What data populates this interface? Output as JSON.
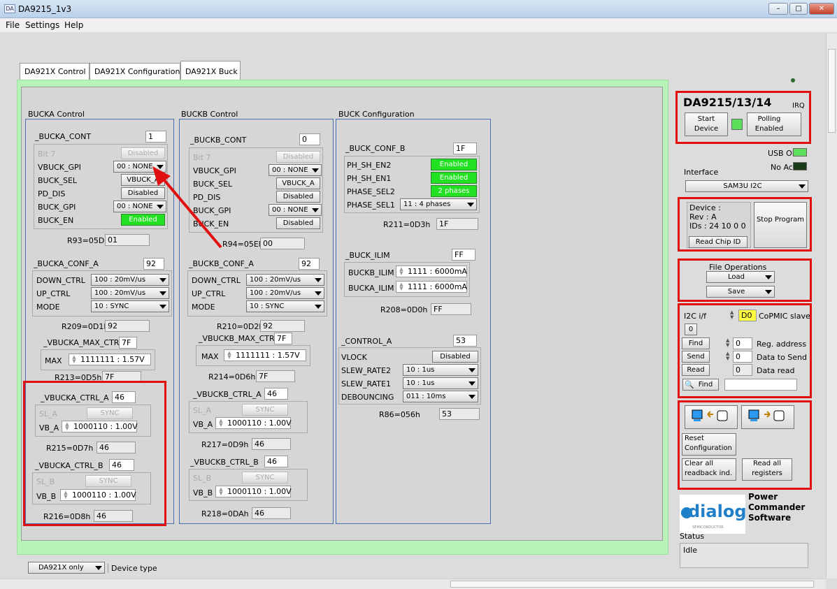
{
  "window": {
    "title": "DA9215_1v3",
    "icon": "app-icon",
    "minimize": "–",
    "maximize": "□",
    "close": "✕"
  },
  "menu": [
    "File",
    "Settings",
    "Help"
  ],
  "tabs": [
    "DA921X Control",
    "DA921X Configuration",
    "DA921X Buck"
  ],
  "bucka": {
    "title": "BUCKA Control",
    "cont": {
      "name": "_BUCKA_CONT",
      "value": "1",
      "rows": [
        {
          "label": "Bit 7",
          "ctrl": "Disabled",
          "type": "dis"
        },
        {
          "label": "VBUCK_GPI",
          "ctrl": "00 : NONE",
          "type": "drop"
        },
        {
          "label": "BUCK_SEL",
          "ctrl": "VBUCK_A",
          "type": "btn"
        },
        {
          "label": "PD_DIS",
          "ctrl": "Disabled",
          "type": "btn"
        },
        {
          "label": "BUCK_GPI",
          "ctrl": "00 : NONE",
          "type": "drop"
        },
        {
          "label": "BUCK_EN",
          "ctrl": "Enabled",
          "type": "on"
        }
      ],
      "reg": "R93=05Dh",
      "regval": "01"
    },
    "conf": {
      "name": "_BUCKA_CONF_A",
      "value": "92",
      "rows": [
        {
          "label": "DOWN_CTRL",
          "ctrl": "100 : 20mV/us"
        },
        {
          "label": "UP_CTRL",
          "ctrl": "100 : 20mV/us"
        },
        {
          "label": "MODE",
          "ctrl": "10 : SYNC"
        }
      ],
      "reg": "R209=0D1h",
      "regval": "92"
    },
    "max": {
      "name": "_VBUCKA_MAX_CTR",
      "value": "7F",
      "label": "MAX",
      "spin": "1111111 : 1.57V",
      "reg": "R213=0D5h",
      "regval": "7F"
    },
    "ctrla": {
      "name": "_VBUCKA_CTRL_A",
      "value": "46",
      "sl": "SL_A",
      "sync": "SYNC",
      "vb": "VB_A",
      "spin": "1000110 : 1.00V",
      "reg": "R215=0D7h",
      "regval": "46"
    },
    "ctrlb": {
      "name": "_VBUCKA_CTRL_B",
      "value": "46",
      "sl": "SL_B",
      "sync": "SYNC",
      "vb": "VB_B",
      "spin": "1000110 : 1.00V",
      "reg": "R216=0D8h",
      "regval": "46"
    }
  },
  "buckb": {
    "title": "BUCKB Control",
    "cont": {
      "name": "_BUCKB_CONT",
      "value": "0",
      "rows": [
        {
          "label": "Bit 7",
          "ctrl": "Disabled",
          "type": "dis"
        },
        {
          "label": "VBUCK_GPI",
          "ctrl": "00 : NONE",
          "type": "drop"
        },
        {
          "label": "BUCK_SEL",
          "ctrl": "VBUCK_A",
          "type": "btn"
        },
        {
          "label": "PD_DIS",
          "ctrl": "Disabled",
          "type": "btn"
        },
        {
          "label": "BUCK_GPI",
          "ctrl": "00 : NONE",
          "type": "drop"
        },
        {
          "label": "BUCK_EN",
          "ctrl": "Disabled",
          "type": "btn"
        }
      ],
      "reg": "R94=05Eh",
      "regval": "00"
    },
    "conf": {
      "name": "_BUCKB_CONF_A",
      "value": "92",
      "rows": [
        {
          "label": "DOWN_CTRL",
          "ctrl": "100 : 20mV/us"
        },
        {
          "label": "UP_CTRL",
          "ctrl": "100 : 20mV/us"
        },
        {
          "label": "MODE",
          "ctrl": "10 : SYNC"
        }
      ],
      "reg": "R210=0D2h",
      "regval": "92"
    },
    "max": {
      "name": "_VBUCKB_MAX_CTR",
      "value": "7F",
      "label": "MAX",
      "spin": "1111111 : 1.57V",
      "reg": "R214=0D6h",
      "regval": "7F"
    },
    "ctrla": {
      "name": "_VBUCKB_CTRL_A",
      "value": "46",
      "sl": "SL_A",
      "sync": "SYNC",
      "vb": "VB_A",
      "spin": "1000110 : 1.00V",
      "reg": "R217=0D9h",
      "regval": "46"
    },
    "ctrlb": {
      "name": "_VBUCKB_CTRL_B",
      "value": "46",
      "sl": "SL_B",
      "sync": "SYNC",
      "vb": "VB_B",
      "spin": "1000110 : 1.00V",
      "reg": "R218=0DAh",
      "regval": "46"
    }
  },
  "buckconf": {
    "title": "BUCK Configuration",
    "confb": {
      "name": "_BUCK_CONF_B",
      "value": "1F",
      "rows": [
        {
          "label": "PH_SH_EN2",
          "ctrl": "Enabled",
          "type": "on"
        },
        {
          "label": "PH_SH_EN1",
          "ctrl": "Enabled",
          "type": "on"
        },
        {
          "label": "PHASE_SEL2",
          "ctrl": "2 phases",
          "type": "on"
        },
        {
          "label": "PHASE_SEL1",
          "ctrl": "11 : 4 phases",
          "type": "drop"
        }
      ],
      "reg": "R211=0D3h",
      "regval": "1F"
    },
    "ilim": {
      "name": "_BUCK_ILIM",
      "value": "FF",
      "rows": [
        {
          "label": "BUCKB_ILIM",
          "spin": "1111 : 6000mA"
        },
        {
          "label": "BUCKA_ILIM",
          "spin": "1111 : 6000mA"
        }
      ],
      "reg": "R208=0D0h",
      "regval": "FF"
    },
    "ctrla": {
      "name": "_CONTROL_A",
      "value": "53",
      "rows": [
        {
          "label": "VLOCK",
          "ctrl": "Disabled",
          "type": "btn"
        },
        {
          "label": "SLEW_RATE2",
          "ctrl": "10 : 1us",
          "type": "drop"
        },
        {
          "label": "SLEW_RATE1",
          "ctrl": "10 : 1us",
          "type": "drop"
        },
        {
          "label": "DEBOUNCING",
          "ctrl": "011 : 10ms",
          "type": "drop"
        }
      ],
      "reg": "R86=056h",
      "regval": "53"
    }
  },
  "right": {
    "device": "DA9215/13/14",
    "irq": "IRQ",
    "start": "Start Device",
    "polling": "Polling Enabled",
    "usb": "USB OK?",
    "noack": "No Ack",
    "interface_label": "Interface",
    "interface": "SAM3U I2C",
    "dev_info": "Device :",
    "rev": "Rev : A",
    "ids": "IDs : 24 10 0 0",
    "read_chip": "Read Chip ID",
    "stop": "Stop Program",
    "fileops": "File Operations",
    "load": "Load",
    "save": "Save",
    "i2c_if": "I2C i/f",
    "slave_val": "D0",
    "slave": "CoPMIC slave",
    "zero": "0",
    "find": "Find",
    "send": "Send",
    "read": "Read",
    "reg_addr": "Reg. address",
    "data_send": "Data to Send",
    "data_read": "Data read",
    "v0": "0",
    "find2": "Find",
    "reset": "Reset Configuration",
    "clear": "Clear all readback ind.",
    "readall": "Read all registers",
    "brand": "dialog",
    "brand_sub": "SEMICONDUCTOR",
    "product": "Power Commander Software",
    "status_label": "Status",
    "status": "Idle"
  },
  "bottom": {
    "device_type_val": "DA921X only",
    "device_type": "Device type"
  },
  "colors": {
    "green_on": "#22e022",
    "red_frame": "#e01010",
    "tab_bg": "#b8f3b8"
  }
}
